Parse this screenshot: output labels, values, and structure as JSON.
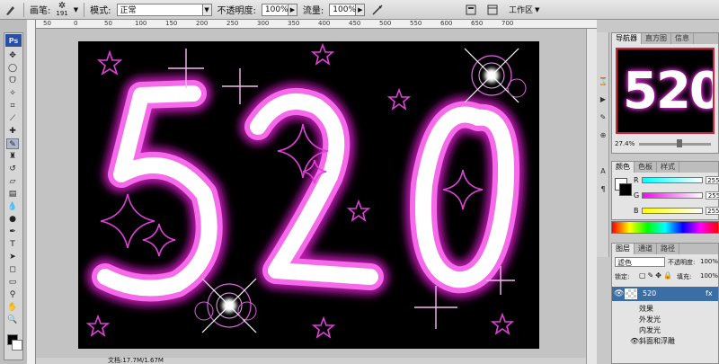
{
  "options_bar": {
    "brush_label": "画笔:",
    "brush_size": "191",
    "mode_label": "模式:",
    "mode_value": "正常",
    "opacity_label": "不透明度:",
    "opacity_value": "100%",
    "flow_label": "流量:",
    "flow_value": "100%",
    "workspace_label": "工作区"
  },
  "ruler": {
    "h_labels": [
      "50",
      "0",
      "50",
      "100",
      "150",
      "200",
      "250",
      "300",
      "350",
      "400",
      "450",
      "500",
      "550",
      "600",
      "650",
      "700"
    ]
  },
  "status": {
    "text": "文档:17.7M/1.67M"
  },
  "canvas": {
    "text": "520",
    "colors": {
      "glow": "#d21fc4",
      "core": "#ffffff",
      "background": "#000000"
    }
  },
  "navigator": {
    "tabs": [
      "导航器",
      "直方图",
      "信息"
    ],
    "zoom": "27.4%",
    "preview_text": "520"
  },
  "color_panel": {
    "tabs": [
      "颜色",
      "色板",
      "样式"
    ],
    "channels": [
      {
        "label": "R",
        "value": "255"
      },
      {
        "label": "G",
        "value": "255"
      },
      {
        "label": "B",
        "value": "255"
      }
    ]
  },
  "layers_panel": {
    "tabs": [
      "图层",
      "通道",
      "路径"
    ],
    "blend_mode": "滤色",
    "opacity_label": "不透明度:",
    "opacity_value": "100%",
    "lock_label": "锁定:",
    "fill_label": "填充:",
    "fill_value": "100%",
    "layer_name": "520",
    "effects": [
      "效果",
      "外发光",
      "内发光",
      "斜面和浮雕"
    ]
  }
}
